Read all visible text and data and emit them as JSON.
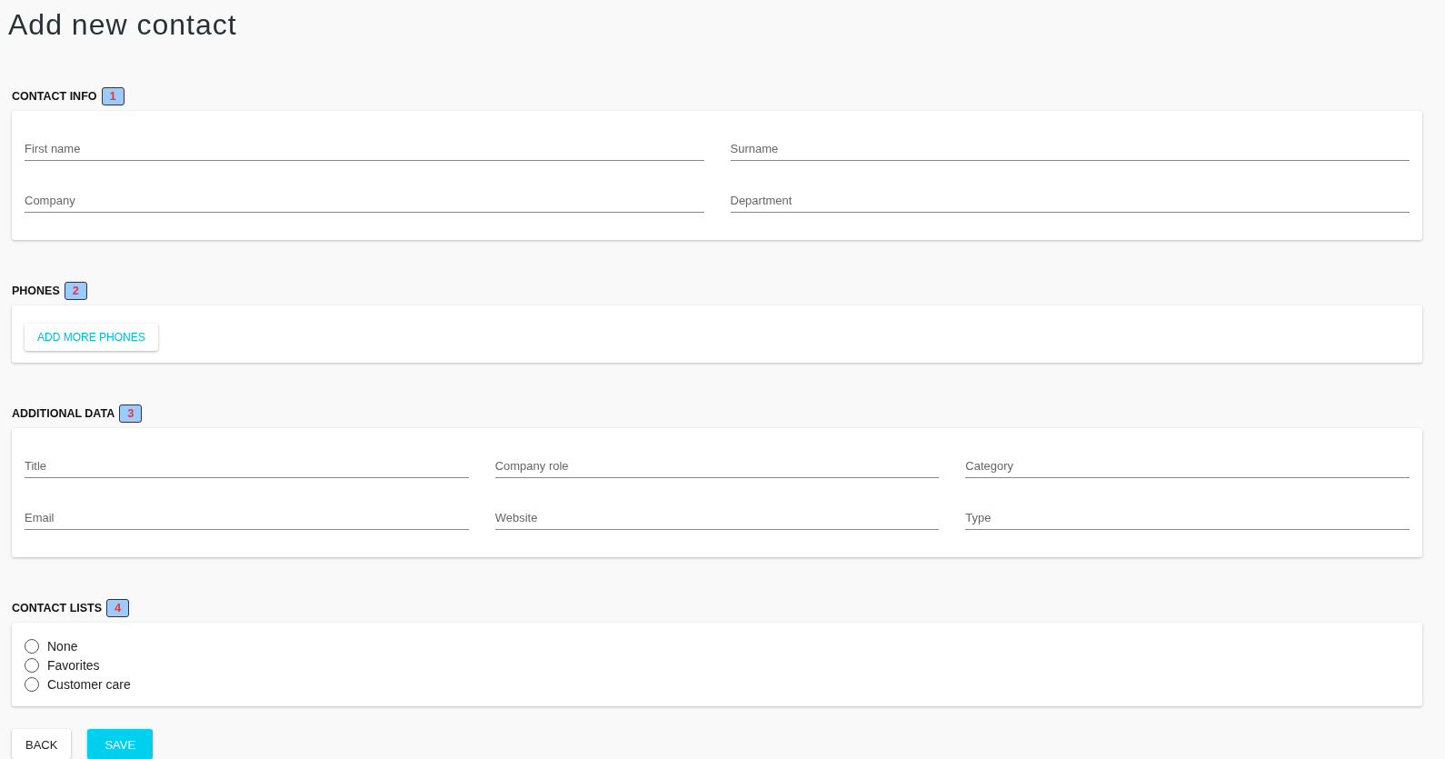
{
  "page_title": "Add new contact",
  "sections": [
    {
      "kind": "fields",
      "heading": "CONTACT INFO",
      "badge": "1",
      "fields": [
        {
          "placeholder": "First name"
        },
        {
          "placeholder": "Surname"
        },
        {
          "placeholder": "Company"
        },
        {
          "placeholder": "Department"
        }
      ]
    },
    {
      "kind": "buttons",
      "heading": "PHONES",
      "badge": "2",
      "buttons": [
        "ADD MORE PHONES"
      ]
    },
    {
      "kind": "fields",
      "heading": "ADDITIONAL DATA",
      "badge": "3",
      "fields": [
        {
          "placeholder": "Title"
        },
        {
          "placeholder": "Company role"
        },
        {
          "placeholder": "Category"
        },
        {
          "placeholder": "Email"
        },
        {
          "placeholder": "Website"
        },
        {
          "placeholder": "Type"
        }
      ]
    },
    {
      "kind": "radios",
      "heading": "CONTACT LISTS",
      "badge": "4",
      "options": [
        {
          "label": "None",
          "selected": false
        },
        {
          "label": "Favorites",
          "selected": false
        },
        {
          "label": "Customer care",
          "selected": false
        }
      ]
    }
  ],
  "actions": [
    {
      "label": "BACK",
      "kind": "plain"
    },
    {
      "label": "SAVE",
      "kind": "primary"
    }
  ]
}
